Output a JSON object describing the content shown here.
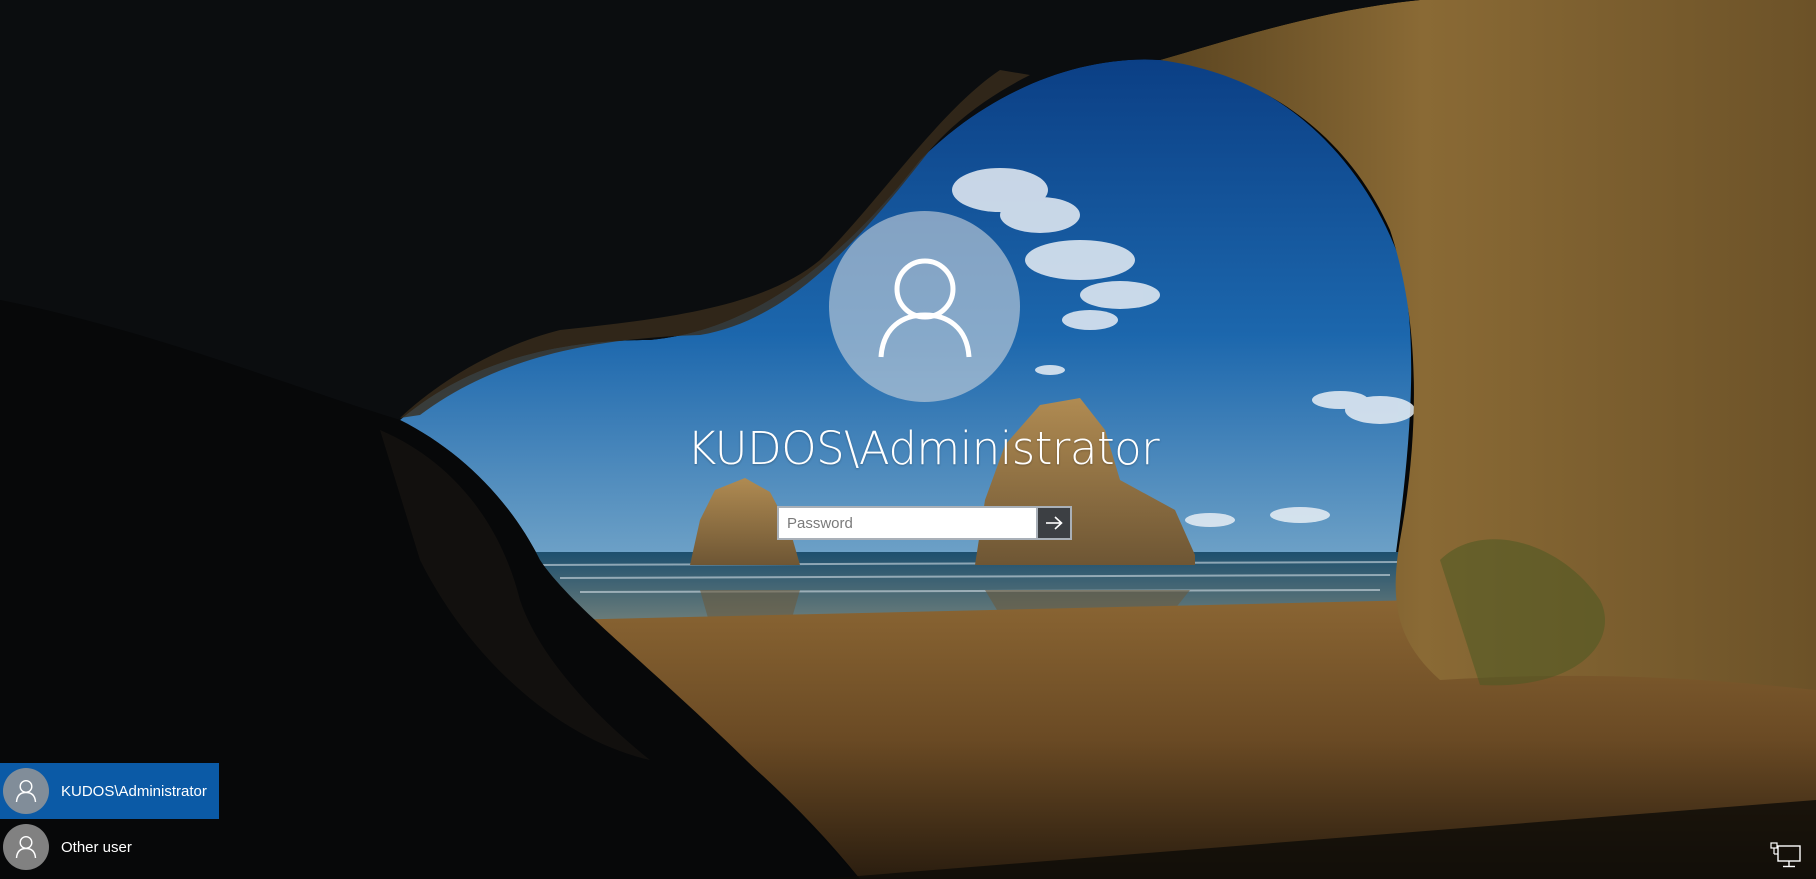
{
  "lock_screen": {
    "username": "KUDOS\\Administrator",
    "password_placeholder": "Password",
    "submit_icon": "arrow-right-icon"
  },
  "user_list": {
    "items": [
      {
        "label": "KUDOS\\Administrator",
        "icon": "user-icon",
        "selected": true
      },
      {
        "label": "Other user",
        "icon": "user-icon",
        "selected": false
      }
    ]
  },
  "system": {
    "network_icon": "network-icon"
  },
  "colors": {
    "accent": "#0b5aa6",
    "submit_bg": "#3c3f43",
    "text": "#ffffff"
  }
}
